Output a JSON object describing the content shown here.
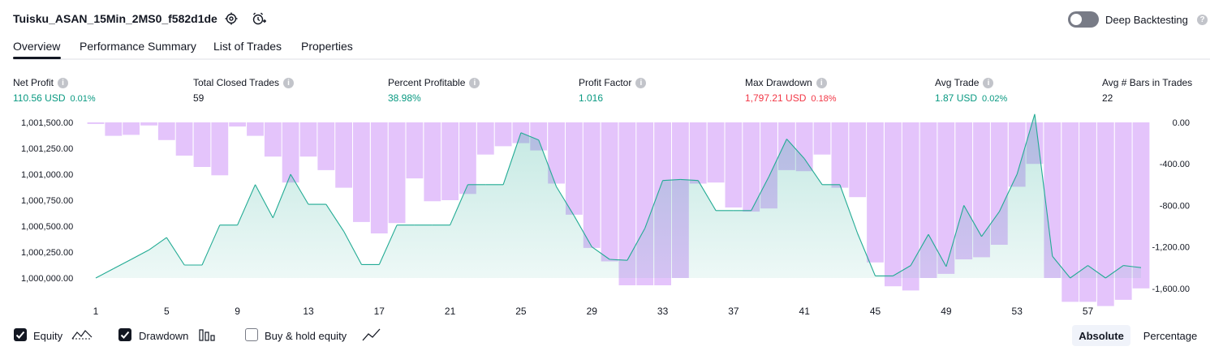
{
  "header": {
    "title": "Tuisku_ASAN_15Min_2MS0_f582d1de",
    "deep_backtesting_label": "Deep Backtesting",
    "deep_backtesting_on": false
  },
  "tabs": [
    {
      "label": "Overview",
      "active": true
    },
    {
      "label": "Performance Summary",
      "active": false
    },
    {
      "label": "List of Trades",
      "active": false
    },
    {
      "label": "Properties",
      "active": false
    }
  ],
  "metrics": [
    {
      "label": "Net Profit",
      "value": "110.56 USD",
      "pct": "0.01%",
      "color": "#089981"
    },
    {
      "label": "Total Closed Trades",
      "value": "59",
      "pct": "",
      "color": "#131722"
    },
    {
      "label": "Percent Profitable",
      "value": "38.98%",
      "pct": "",
      "color": "#089981"
    },
    {
      "label": "Profit Factor",
      "value": "1.016",
      "pct": "",
      "color": "#089981"
    },
    {
      "label": "Max Drawdown",
      "value": "1,797.21 USD",
      "pct": "0.18%",
      "color": "#f23645"
    },
    {
      "label": "Avg Trade",
      "value": "1.87 USD",
      "pct": "0.02%",
      "color": "#089981"
    },
    {
      "label": "Avg # Bars in Trades",
      "value": "22",
      "pct": "",
      "color": "#131722"
    }
  ],
  "chart_data": {
    "type": "area",
    "y_left_ticks": [
      "1,001,500.00",
      "1,001,250.00",
      "1,001,000.00",
      "1,000,750.00",
      "1,000,500.00",
      "1,000,250.00",
      "1,000,000.00"
    ],
    "y_right_ticks": [
      "0.00",
      "-400.00",
      "-800.00",
      "-1,200.00",
      "-1,600.00"
    ],
    "x_ticks": [
      "1",
      "5",
      "9",
      "13",
      "17",
      "21",
      "25",
      "29",
      "33",
      "37",
      "41",
      "45",
      "49",
      "53",
      "57"
    ],
    "ylim_left": [
      1000000,
      1001500
    ],
    "ylim_right": [
      -1750,
      0
    ],
    "series": [
      {
        "name": "Equity",
        "color": "#22ab94",
        "x": [
          1,
          2,
          3,
          4,
          5,
          6,
          7,
          8,
          9,
          10,
          11,
          12,
          13,
          14,
          15,
          16,
          17,
          18,
          19,
          20,
          21,
          22,
          23,
          24,
          25,
          26,
          27,
          28,
          29,
          30,
          31,
          32,
          33,
          34,
          35,
          36,
          37,
          38,
          39,
          40,
          41,
          42,
          43,
          44,
          45,
          46,
          47,
          48,
          49,
          50,
          51,
          52,
          53,
          54,
          55,
          56,
          57,
          58,
          59,
          60
        ],
        "values": [
          1000000,
          1000090,
          1000180,
          1000270,
          1000390,
          1000125,
          1000125,
          1000510,
          1000510,
          1000900,
          1000580,
          1001000,
          1000710,
          1000710,
          1000450,
          1000130,
          1000130,
          1000510,
          1000510,
          1000510,
          1000510,
          1000900,
          1000900,
          1000900,
          1001400,
          1001330,
          1000880,
          1000600,
          1000300,
          1000180,
          1000170,
          1000480,
          1000940,
          1000950,
          1000940,
          1000650,
          1000650,
          1000650,
          1000980,
          1001340,
          1001150,
          1000900,
          1000900,
          1000430,
          1000020,
          1000020,
          1000120,
          1000420,
          1000110,
          1000700,
          1000400,
          1000640,
          1001000,
          1001580,
          1000210,
          1000000,
          1000120,
          1000000,
          1000120,
          1000100
        ]
      },
      {
        "name": "Drawdown",
        "color": "#b39ddb",
        "x": [
          1,
          2,
          3,
          4,
          5,
          6,
          7,
          8,
          9,
          10,
          11,
          12,
          13,
          14,
          15,
          16,
          17,
          18,
          19,
          20,
          21,
          22,
          23,
          24,
          25,
          26,
          27,
          28,
          29,
          30,
          31,
          32,
          33,
          34,
          35,
          36,
          37,
          38,
          39,
          40,
          41,
          42,
          43,
          44,
          45,
          46,
          47,
          48,
          49,
          50,
          51,
          52,
          53,
          54,
          55,
          56,
          57,
          58,
          59,
          60
        ],
        "values": [
          -15,
          -130,
          -120,
          -30,
          -170,
          -320,
          -430,
          -510,
          -40,
          -130,
          -330,
          -580,
          -330,
          -460,
          -630,
          -960,
          -1070,
          -970,
          -540,
          -760,
          -750,
          -690,
          -310,
          -230,
          -200,
          -270,
          -590,
          -890,
          -1210,
          -1340,
          -1570,
          -1570,
          -1570,
          -1500,
          -590,
          -580,
          -820,
          -860,
          -830,
          -460,
          -470,
          -310,
          -630,
          -720,
          -1350,
          -1580,
          -1620,
          -1500,
          -1460,
          -1320,
          -1300,
          -1180,
          -620,
          -400,
          -1500,
          -1730,
          -1730,
          -1770,
          -1710,
          -1600
        ]
      }
    ]
  },
  "legend": {
    "equity": {
      "label": "Equity",
      "checked": true
    },
    "drawdown": {
      "label": "Drawdown",
      "checked": true
    },
    "buy_hold": {
      "label": "Buy & hold equity",
      "checked": false
    }
  },
  "mode_buttons": {
    "absolute": "Absolute",
    "percentage": "Percentage",
    "active": "absolute"
  }
}
